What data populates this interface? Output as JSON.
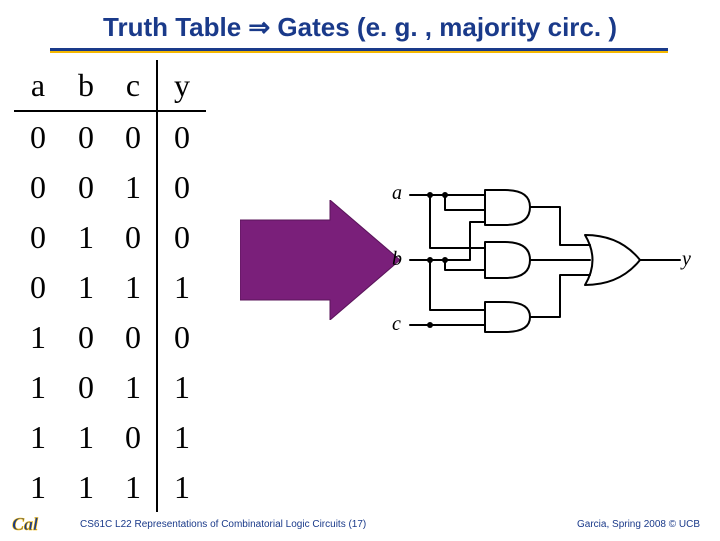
{
  "title": "Truth Table ⇒ Gates (e. g. , majority circ. )",
  "truth_table": {
    "headers": [
      "a",
      "b",
      "c",
      "y"
    ],
    "rows": [
      [
        "0",
        "0",
        "0",
        "0"
      ],
      [
        "0",
        "0",
        "1",
        "0"
      ],
      [
        "0",
        "1",
        "0",
        "0"
      ],
      [
        "0",
        "1",
        "1",
        "1"
      ],
      [
        "1",
        "0",
        "0",
        "0"
      ],
      [
        "1",
        "0",
        "1",
        "1"
      ],
      [
        "1",
        "1",
        "0",
        "1"
      ],
      [
        "1",
        "1",
        "1",
        "1"
      ]
    ]
  },
  "circuit": {
    "inputs": [
      "a",
      "b",
      "c"
    ],
    "output": "y"
  },
  "footer": {
    "left": "CS61C L22 Representations of Combinatorial Logic Circuits (17)",
    "right": "Garcia, Spring 2008 © UCB"
  }
}
